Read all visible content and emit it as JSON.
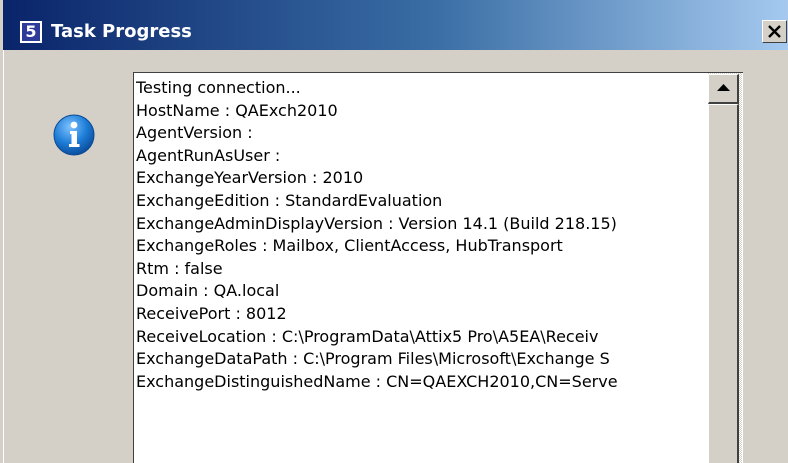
{
  "window": {
    "title": "Task Progress",
    "app_icon_glyph": "5",
    "app_icon_name": "attix5-app-icon",
    "close_icon": "close-icon",
    "colors": {
      "titlebar_start": "#0a246a",
      "titlebar_end": "#a6caf0",
      "face": "#d4d0c8",
      "info_icon": "#1c7cd6"
    }
  },
  "dialog": {
    "icon": "info-icon",
    "lines": [
      "Testing connection...",
      "HostName : QAExch2010",
      "AgentVersion :",
      "AgentRunAsUser :",
      "ExchangeYearVersion : 2010",
      "ExchangeEdition : StandardEvaluation",
      "ExchangeAdminDisplayVersion : Version 14.1 (Build 218.15)",
      "ExchangeRoles : Mailbox, ClientAccess, HubTransport",
      "Rtm : false",
      "Domain : QA.local",
      "ReceivePort : 8012",
      "ReceiveLocation : C:\\ProgramData\\Attix5 Pro\\A5EA\\Receiv",
      "ExchangeDataPath : C:\\Program Files\\Microsoft\\Exchange S",
      "ExchangeDistinguishedName : CN=QAEXCH2010,CN=Serve"
    ]
  },
  "scrollbar": {
    "up_icon": "scroll-up-arrow-icon"
  }
}
